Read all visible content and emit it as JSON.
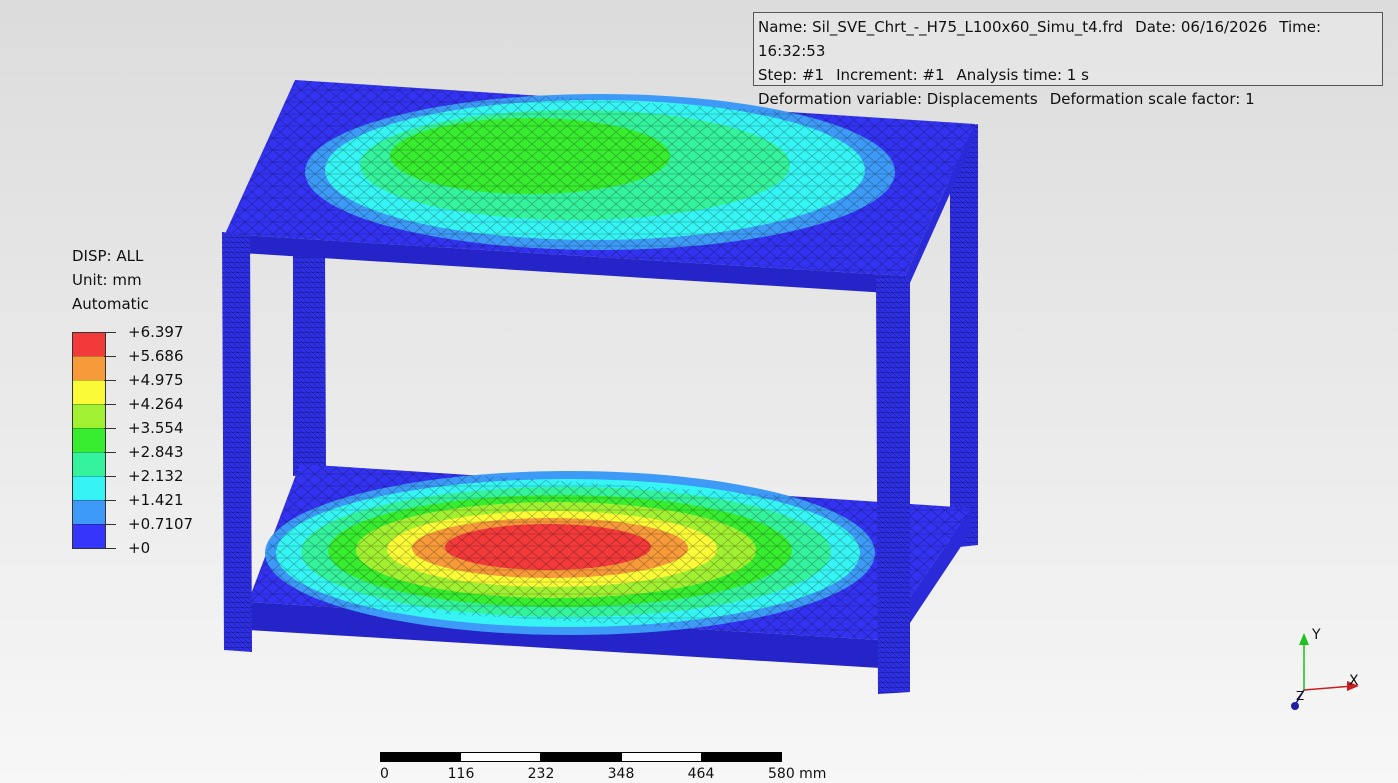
{
  "info": {
    "name": "Name: Sil_SVE_Chrt_-_H75_L100x60_Simu_t4.frd",
    "date": "Date: 06/16/2026",
    "time": "Time: 16:32:53",
    "step": "Step: #1",
    "increment": "Increment: #1",
    "analysis_time": "Analysis time: 1 s",
    "deformation_variable": "Deformation variable: Displacements",
    "deformation_scale": "Deformation scale factor: 1"
  },
  "legend": {
    "title": "DISP: ALL",
    "unit": "Unit: mm",
    "mode": "Automatic",
    "labels": [
      "+6.397",
      "+5.686",
      "+4.975",
      "+4.264",
      "+3.554",
      "+2.843",
      "+2.132",
      "+1.421",
      "+0.7107",
      "+0"
    ],
    "colors": [
      "#f23a3a",
      "#f79a3a",
      "#fafa38",
      "#a2f032",
      "#38ec30",
      "#35f29c",
      "#36f4f4",
      "#3d9af6",
      "#3636fa"
    ]
  },
  "scale_bar": {
    "ticks": [
      "0",
      "116",
      "232",
      "348",
      "464",
      "580 mm"
    ]
  },
  "axes": {
    "x": "X",
    "y": "Y",
    "z": "Z"
  }
}
